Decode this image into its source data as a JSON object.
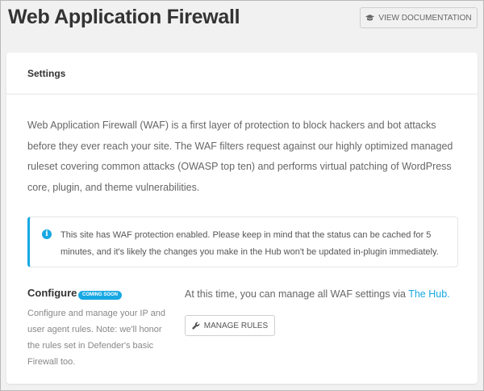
{
  "header": {
    "title": "Web Application Firewall",
    "doc_button": {
      "label": "VIEW DOCUMENTATION",
      "icon": "graduation-cap-icon"
    }
  },
  "settings": {
    "title": "Settings",
    "intro": "Web Application Firewall (WAF) is a first layer of protection to block hackers and bot attacks before they ever reach your site. The WAF filters request against our highly optimized managed ruleset covering common attacks (OWASP top ten) and performs virtual patching of WordPress core, plugin, and theme vulnerabilities.",
    "notice": {
      "icon": "info-icon",
      "text": "This site has WAF protection enabled. Please keep in mind that the status can be cached for 5 minutes, and it's likely the changes you make in the Hub won't be updated in-plugin immediately."
    },
    "configure": {
      "title": "Configure",
      "badge": "COMING SOON",
      "description": "Configure and manage your IP and user agent rules. Note: we'll honor the rules set in Defender's basic Firewall too.",
      "hub_text": "At this time, you can manage all WAF settings via ",
      "hub_link": "The Hub.",
      "manage_button": {
        "label": "MANAGE RULES",
        "icon": "wrench-icon"
      }
    }
  },
  "colors": {
    "accent": "#17a8e3",
    "background": "#f1f1f1",
    "card": "#ffffff",
    "text": "#333333",
    "muted_text": "#888888"
  }
}
